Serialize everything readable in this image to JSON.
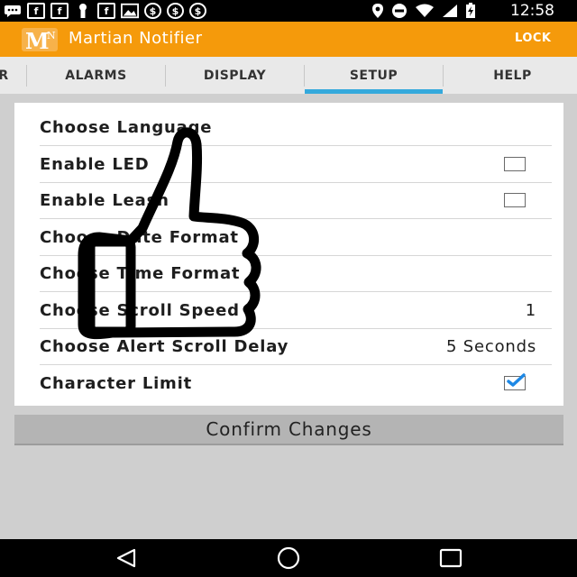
{
  "status_bar": {
    "time": "12:58",
    "left_icons": [
      "messenger-icon",
      "facebook-icon",
      "facebook-icon",
      "keyhole-icon",
      "facebook-icon",
      "image-icon",
      "dollar-icon",
      "dollar-icon",
      "dollar-icon"
    ],
    "right_icons": [
      "location-icon",
      "do-not-disturb-icon",
      "wifi-icon",
      "cell-signal-icon",
      "battery-icon"
    ]
  },
  "app_bar": {
    "logo_letter": "M",
    "logo_sub": "N",
    "title": "Martian Notifier",
    "lock_label": "LOCK"
  },
  "tabs": [
    {
      "label": "R"
    },
    {
      "label": "ALARMS"
    },
    {
      "label": "DISPLAY"
    },
    {
      "label": "SETUP",
      "active": true
    },
    {
      "label": "HELP"
    }
  ],
  "settings": [
    {
      "label": "Choose Language"
    },
    {
      "label": "Enable LED",
      "checkbox": false
    },
    {
      "label": "Enable Leash",
      "checkbox": false
    },
    {
      "label": "Choose Date Format"
    },
    {
      "label": "Choose Time Format"
    },
    {
      "label": "Choose Scroll Speed",
      "value": "1"
    },
    {
      "label": "Choose Alert Scroll Delay",
      "value": "5 Seconds"
    },
    {
      "label": "Character Limit",
      "checkbox": true
    }
  ],
  "confirm_label": "Confirm Changes",
  "colors": {
    "app_bar": "#f59a0b",
    "tab_indicator": "#34a9dc",
    "check": "#1e88e5"
  }
}
